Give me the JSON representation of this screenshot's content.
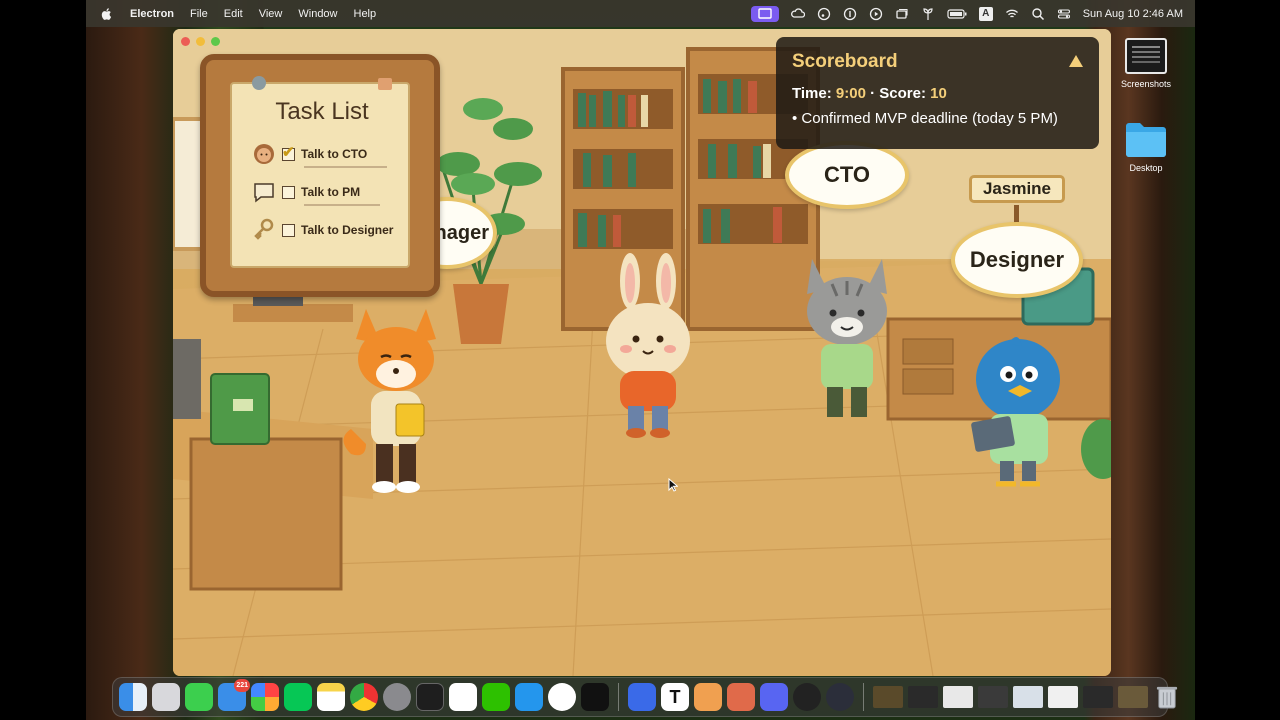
{
  "menubar": {
    "app_name": "Electron",
    "menus": [
      "File",
      "Edit",
      "View",
      "Window",
      "Help"
    ],
    "clock": "Sun Aug 10  2:46 AM"
  },
  "desktop_icons": {
    "screenshots": "Screenshots",
    "desktop": "Desktop"
  },
  "game": {
    "task_list": {
      "title": "Task List",
      "tasks": [
        {
          "label": "Talk to CTO",
          "done": true,
          "icon": "person-avatar-icon"
        },
        {
          "label": "Talk to PM",
          "done": false,
          "icon": "chat-bubble-icon"
        },
        {
          "label": "Talk to Designer",
          "done": false,
          "icon": "key-icon"
        }
      ]
    },
    "bubbles": {
      "cto": "CTO",
      "designer": "Designer",
      "manager_partial": "nager",
      "jasmine": "Jasmine"
    },
    "scoreboard": {
      "title": "Scoreboard",
      "time_label": "Time:",
      "time_value": "9:00",
      "separator": "·",
      "score_label": "Score:",
      "score_value": "10",
      "log": [
        "• Confirmed MVP deadline (today 5 PM)"
      ]
    }
  },
  "dock": {
    "mail_badge": "221",
    "text_app": "T"
  },
  "colors": {
    "accent_gold": "#f4cf7a",
    "bubble_border": "#e8c46a",
    "board_wood": "#b57a3e"
  }
}
